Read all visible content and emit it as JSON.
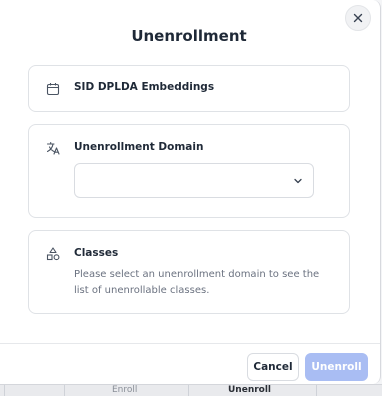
{
  "dialog": {
    "title": "Unenrollment",
    "close_icon": "close-icon"
  },
  "model_card": {
    "icon": "calendar-icon",
    "label": "SID DPLDA Embeddings"
  },
  "domain_card": {
    "icon": "language-icon",
    "label": "Unenrollment Domain",
    "select_value": "",
    "select_icon": "chevron-down-icon"
  },
  "classes_card": {
    "icon": "shapes-icon",
    "label": "Classes",
    "description": "Please select an unenrollment domain to see the list of unenrollable classes."
  },
  "footer": {
    "cancel_label": "Cancel",
    "unenroll_label": "Unenroll"
  },
  "background": {
    "cells": [
      "Enroll",
      "Unenroll"
    ]
  },
  "colors": {
    "primary_disabled": "#a9bdf3",
    "border": "#dfe2e6",
    "text": "#1f2937",
    "muted_text": "#6b7280"
  }
}
